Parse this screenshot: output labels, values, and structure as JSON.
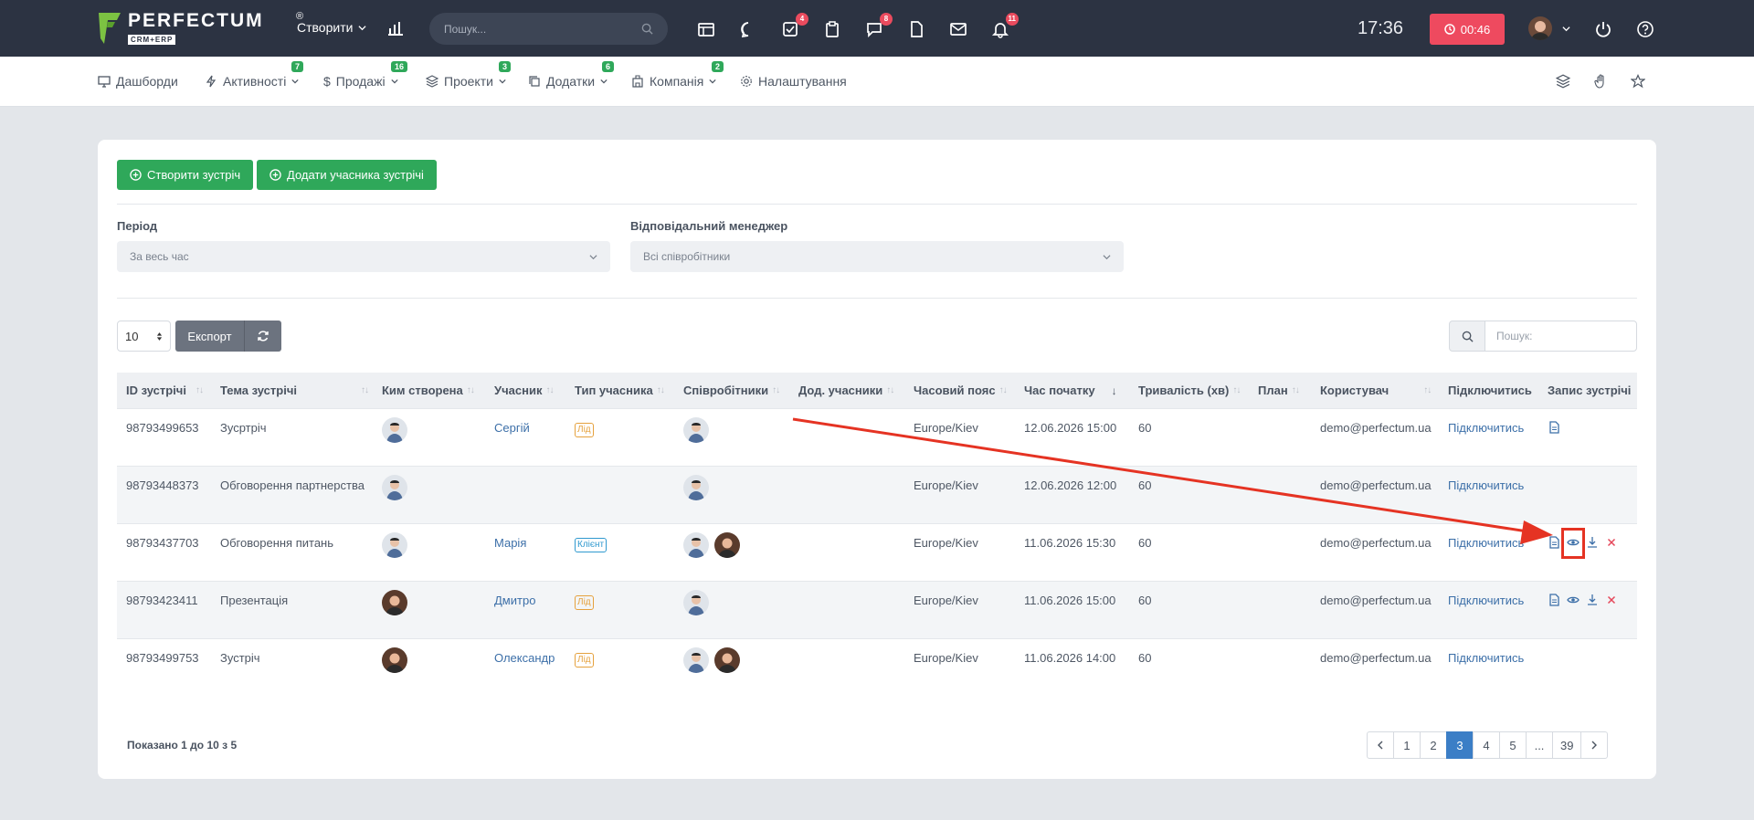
{
  "header": {
    "logo_text": "PERFECTUM",
    "logo_sub": "CRM+ERP",
    "logo_reg": "®",
    "create_label": "Створити",
    "search_placeholder": "Пошук...",
    "clock": "17:36",
    "timer": "00:46",
    "badges": {
      "tasks": "4",
      "chat": "8",
      "notifications": "11"
    }
  },
  "nav": {
    "items": [
      {
        "label": "Дашборди"
      },
      {
        "label": "Активності",
        "badge": "7"
      },
      {
        "label": "Продажі",
        "badge": "16"
      },
      {
        "label": "Проекти",
        "badge": "3"
      },
      {
        "label": "Додатки",
        "badge": "6"
      },
      {
        "label": "Компанія",
        "badge": "2"
      },
      {
        "label": "Налаштування"
      }
    ]
  },
  "toolbar": {
    "create_meeting": "Створити зустріч",
    "add_participant": "Додати учасника зустрічі"
  },
  "filters": {
    "period_label": "Період",
    "period_value": "За весь час",
    "manager_label": "Відповідальний менеджер",
    "manager_value": "Всі співробітники"
  },
  "table_controls": {
    "page_size": "10",
    "export_label": "Експорт",
    "search_placeholder": "Пошук:"
  },
  "table": {
    "headers": [
      "ID зустрічі",
      "Тема зустрічі",
      "Ким створена",
      "Учасник",
      "Тип учасника",
      "Співробітники",
      "Дод. учасники",
      "Часовий пояс",
      "Час початку",
      "Тривалість (хв)",
      "План",
      "Користувач",
      "Підключитись",
      "Запис зустрічі"
    ],
    "rows": [
      {
        "id": "98793499653",
        "topic": "Зусртріч",
        "participant": "Сергій",
        "type": "Лід",
        "tz": "Europe/Kiev",
        "start": "12.06.2026 15:00",
        "duration": "60",
        "user": "demo@perfectum.ua",
        "connect": "Підключитись"
      },
      {
        "id": "98793448373",
        "topic": "Обговорення партнерства",
        "participant": "",
        "type": "",
        "tz": "Europe/Kiev",
        "start": "12.06.2026 12:00",
        "duration": "60",
        "user": "demo@perfectum.ua",
        "connect": "Підключитись"
      },
      {
        "id": "98793437703",
        "topic": "Обговорення питань",
        "participant": "Марія",
        "type": "Клієнт",
        "tz": "Europe/Kiev",
        "start": "11.06.2026 15:30",
        "duration": "60",
        "user": "demo@perfectum.ua",
        "connect": "Підключитись"
      },
      {
        "id": "98793423411",
        "topic": "Презентація",
        "participant": "Дмитро",
        "type": "Лід",
        "tz": "Europe/Kiev",
        "start": "11.06.2026 15:00",
        "duration": "60",
        "user": "demo@perfectum.ua",
        "connect": "Підключитись"
      },
      {
        "id": "98793499753",
        "topic": "Зустріч",
        "participant": "Олександр",
        "type": "Лід",
        "tz": "Europe/Kiev",
        "start": "11.06.2026 14:00",
        "duration": "60",
        "user": "demo@perfectum.ua",
        "connect": "Підключитись"
      }
    ]
  },
  "footer": {
    "info": "Показано 1 до 10 з 5",
    "pages": [
      "1",
      "2",
      "3",
      "4",
      "5",
      "...",
      "39"
    ],
    "active_page": "3"
  },
  "colors": {
    "topbar": "#2c3342",
    "green": "#2fa85a",
    "timer": "#ee4a5f",
    "link": "#3c6fa8",
    "annotation": "#e53323"
  }
}
